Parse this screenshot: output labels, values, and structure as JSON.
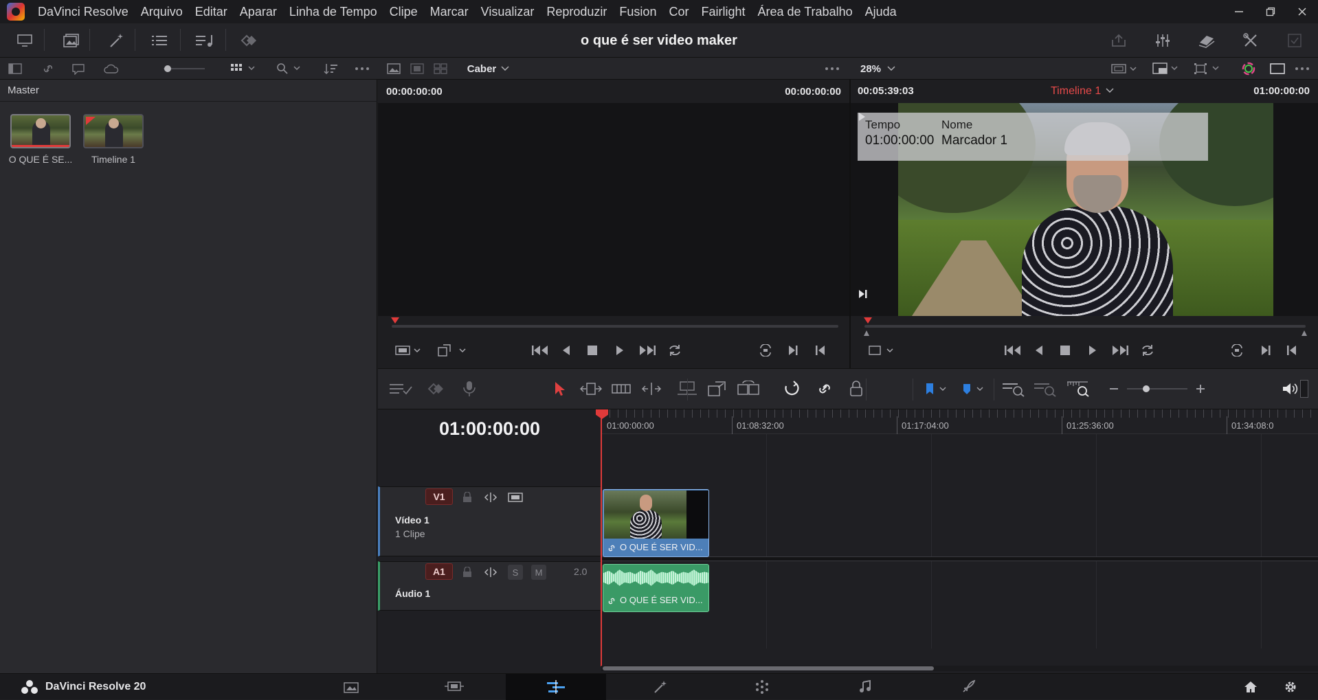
{
  "menubar": {
    "app_name": "DaVinci Resolve",
    "items": [
      "Arquivo",
      "Editar",
      "Aparar",
      "Linha de Tempo",
      "Clipe",
      "Marcar",
      "Visualizar",
      "Reproduzir",
      "Fusion",
      "Cor",
      "Fairlight",
      "Área de Trabalho",
      "Ajuda"
    ]
  },
  "toolbar": {
    "project_title": "o que é ser video maker"
  },
  "subtoolbar": {
    "fit_label": "Caber",
    "zoom_label": "28%"
  },
  "media_pool": {
    "header": "Master",
    "items": [
      {
        "label": "O QUE É SE...",
        "type": "clip"
      },
      {
        "label": "Timeline 1",
        "type": "timeline"
      }
    ]
  },
  "source_viewer": {
    "tc_left": "00:00:00:00",
    "tc_right": "00:00:00:00"
  },
  "timeline_viewer": {
    "tc_left": "00:05:39:03",
    "timeline_name": "Timeline 1",
    "tc_right": "01:00:00:00",
    "marker_overlay": {
      "time_label": "Tempo",
      "time_value": "01:00:00:00",
      "name_label": "Nome",
      "name_value": "Marcador 1"
    }
  },
  "timeline": {
    "current_tc": "01:00:00:00",
    "ruler_labels": [
      "01:00:00:00",
      "01:08:32:00",
      "01:17:04:00",
      "01:25:36:00",
      "01:34:08:0"
    ],
    "tracks": {
      "video": {
        "badge": "V1",
        "name": "Vídeo 1",
        "sub": "1 Clipe",
        "clip_label": "O QUE É SER VID..."
      },
      "audio": {
        "badge": "A1",
        "name": "Áudio 1",
        "level": "2.0",
        "s_label": "S",
        "m_label": "M",
        "clip_label": "O QUE É SER VID..."
      }
    }
  },
  "pagebar": {
    "brand": "DaVinci Resolve 20"
  },
  "colors": {
    "accent_red": "#e03a3a",
    "video_clip": "#4d7fb8",
    "audio_clip": "#3a9a66",
    "marker_blue": "#2d7fe0"
  }
}
